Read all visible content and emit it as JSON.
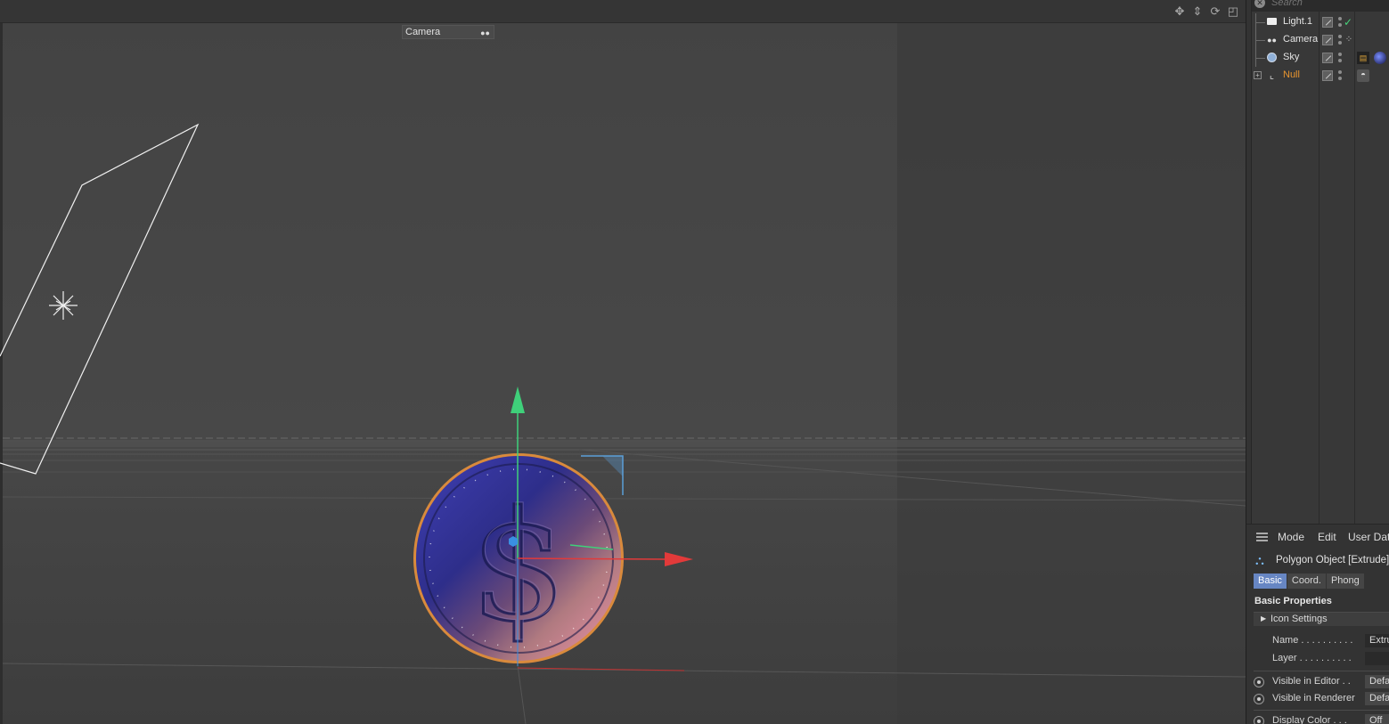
{
  "viewport": {
    "camera_label": "Camera",
    "icons": [
      "move-icon",
      "zoom-icon",
      "rotate-icon",
      "maximize-icon"
    ]
  },
  "object_manager": {
    "search_placeholder": "Search",
    "objects": [
      {
        "name": "Light.1",
        "icon": "light-icon",
        "color": "#e4e4e4"
      },
      {
        "name": "Camera",
        "icon": "camera-icon",
        "color": "#e4e4e4"
      },
      {
        "name": "Sky",
        "icon": "sky-icon",
        "color": "#e4e4e4"
      },
      {
        "name": "Null",
        "icon": "null-icon",
        "color": "#e8952f"
      }
    ]
  },
  "attribute_manager": {
    "menu": [
      "Mode",
      "Edit",
      "User Data"
    ],
    "title": "Polygon Object [Extrude]",
    "tabs": [
      "Basic",
      "Coord.",
      "Phong"
    ],
    "active_tab": "Basic",
    "section": "Basic Properties",
    "group": "Icon Settings",
    "props": {
      "name_label": "Name . . . . . . . . . .",
      "name_value": "Extrude",
      "layer_label": "Layer . . . . . . . . . .",
      "layer_value": "",
      "vis_editor_label": "Visible in Editor . .",
      "vis_editor_value": "Default",
      "vis_render_label": "Visible in Renderer",
      "vis_render_value": "Default",
      "display_color_label": "Display Color . . .",
      "display_color_value": "Off"
    }
  },
  "colors": {
    "accent_tab": "#6786c3",
    "null_object": "#e8952f",
    "axis_x": "#e23a3a",
    "axis_y": "#3fd07a",
    "coin_rim": "#d98a3c"
  }
}
